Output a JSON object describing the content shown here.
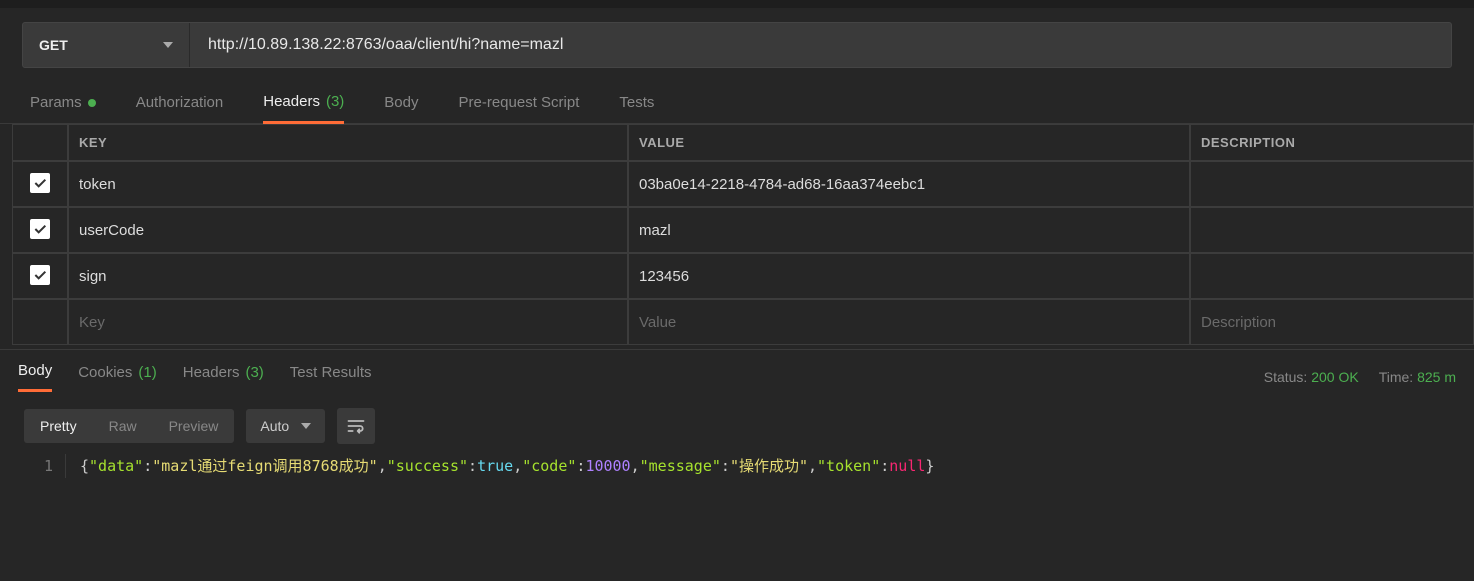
{
  "request": {
    "method": "GET",
    "url": "http://10.89.138.22:8763/oaa/client/hi?name=mazl"
  },
  "request_tabs": {
    "params": "Params",
    "auth": "Authorization",
    "headers": "Headers",
    "headers_count": "(3)",
    "body": "Body",
    "prerequest": "Pre-request Script",
    "tests": "Tests"
  },
  "headers_columns": {
    "key": "KEY",
    "value": "VALUE",
    "description": "DESCRIPTION"
  },
  "headers": [
    {
      "key": "token",
      "value": "03ba0e14-2218-4784-ad68-16aa374eebc1",
      "checked": true
    },
    {
      "key": "userCode",
      "value": "mazl",
      "checked": true
    },
    {
      "key": "sign",
      "value": "123456",
      "checked": true
    }
  ],
  "headers_placeholders": {
    "key": "Key",
    "value": "Value",
    "description": "Description"
  },
  "response_tabs": {
    "body": "Body",
    "cookies": "Cookies",
    "cookies_count": "(1)",
    "headers": "Headers",
    "headers_count": "(3)",
    "test_results": "Test Results"
  },
  "response_status": {
    "status_label": "Status:",
    "status_value": "200 OK",
    "time_label": "Time:",
    "time_value": "825 m"
  },
  "body_toolbar": {
    "pretty": "Pretty",
    "raw": "Raw",
    "preview": "Preview",
    "format": "Auto"
  },
  "response_body": {
    "line_number": "1",
    "tokens": {
      "data_key": "\"data\"",
      "data_val": "\"mazl通过feign调用8768成功\"",
      "success_key": "\"success\"",
      "success_val": "true",
      "code_key": "\"code\"",
      "code_val": "10000",
      "message_key": "\"message\"",
      "message_val": "\"操作成功\"",
      "token_key": "\"token\"",
      "token_val": "null"
    }
  }
}
